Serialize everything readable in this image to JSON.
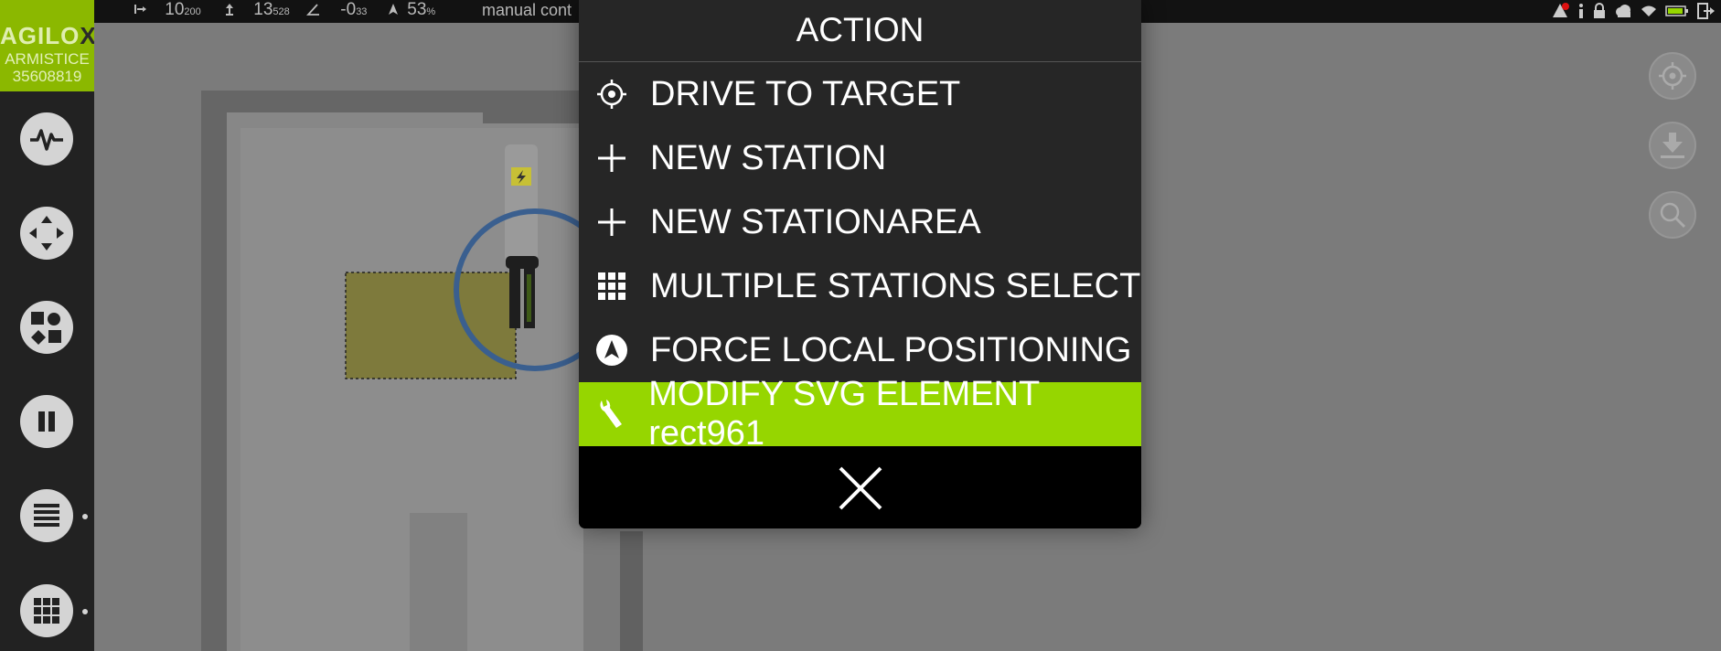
{
  "brand": {
    "logo_main": "AGILO",
    "logo_x": "X",
    "name": "ARMISTICE",
    "serial": "35608819"
  },
  "status": {
    "speed": "10",
    "speed_sub": "200",
    "lift": "13",
    "lift_sub": "528",
    "angle": "-0",
    "angle_sup": "0",
    "angle_sub": "33",
    "battery": "53",
    "battery_unit": "%",
    "mode": "manual cont"
  },
  "sidebar": [
    {
      "icon": "pulse-icon"
    },
    {
      "icon": "move-arrows-icon"
    },
    {
      "icon": "shapes-icon"
    },
    {
      "icon": "pause-icon"
    },
    {
      "icon": "list-icon"
    },
    {
      "icon": "grid-icon"
    }
  ],
  "map": {
    "station_label": "ARMISTICE"
  },
  "modal": {
    "title": "ACTION",
    "items": [
      {
        "label": "DRIVE TO TARGET",
        "icon": "target-icon"
      },
      {
        "label": "NEW STATION",
        "icon": "plus-icon"
      },
      {
        "label": "NEW STATIONAREA",
        "icon": "plus-icon"
      },
      {
        "label": "MULTIPLE STATIONS SELECT",
        "icon": "grid-icon"
      },
      {
        "label": "FORCE LOCAL POSITIONING",
        "icon": "navigation-arrow-icon"
      },
      {
        "label": "MODIFY SVG ELEMENT rect961",
        "icon": "wrench-icon"
      }
    ],
    "close_icon": "close-icon"
  },
  "colors": {
    "accent": "#96d600",
    "brand": "#8bb800",
    "ring": "#3a5f8f",
    "zone": "#7e7a3c"
  }
}
